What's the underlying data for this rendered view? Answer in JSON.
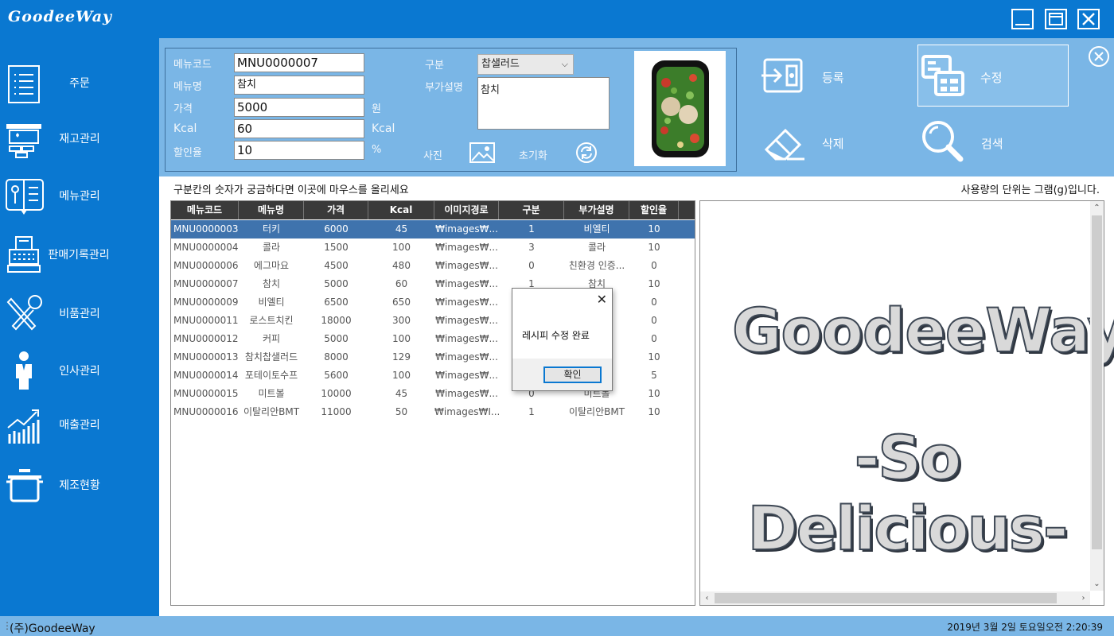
{
  "app": {
    "title": "GoodeeWay"
  },
  "sidebar": {
    "items": [
      {
        "label": "주문",
        "icon": "order-list-icon"
      },
      {
        "label": "재고관리",
        "icon": "inventory-icon"
      },
      {
        "label": "메뉴관리",
        "icon": "menu-icon"
      },
      {
        "label": "판매기록관리",
        "icon": "register-icon"
      },
      {
        "label": "비품관리",
        "icon": "tools-icon"
      },
      {
        "label": "인사관리",
        "icon": "person-icon"
      },
      {
        "label": "매출관리",
        "icon": "sales-chart-icon"
      },
      {
        "label": "제조현황",
        "icon": "pot-icon"
      }
    ]
  },
  "form": {
    "menu_code_label": "메뉴코드",
    "menu_code": "MNU0000007",
    "menu_name_label": "메뉴명",
    "menu_name": "참치",
    "price_label": "가격",
    "price": "5000",
    "price_unit": "원",
    "kcal_label": "Kcal",
    "kcal": "60",
    "kcal_unit": "Kcal",
    "discount_label": "할인율",
    "discount": "10",
    "discount_unit": "%",
    "category_label": "구분",
    "category": "찹샐러드",
    "desc_label": "부가설명",
    "desc": "참치",
    "photo_label": "사진",
    "reset_label": "초기화"
  },
  "actions": {
    "register": "등록",
    "edit": "수정",
    "delete": "삭제",
    "search": "검색"
  },
  "hints": {
    "left": "구분칸의 숫자가 궁금하다면 이곳에 마우스를 올리세요",
    "right": "사용량의 단위는 그램(g)입니다."
  },
  "table": {
    "columns": [
      "메뉴코드",
      "메뉴명",
      "가격",
      "Kcal",
      "이미지경로",
      "구분",
      "부가설명",
      "할인율"
    ],
    "rows": [
      [
        "MNU0000003",
        "터키",
        "6000",
        "45",
        "₩images₩...",
        "1",
        "비엘티",
        "10"
      ],
      [
        "MNU0000004",
        "콜라",
        "1500",
        "100",
        "₩images₩...",
        "3",
        "콜라",
        "10"
      ],
      [
        "MNU0000006",
        "에그마요",
        "4500",
        "480",
        "₩images₩...",
        "0",
        "친환경 인증...",
        "0"
      ],
      [
        "MNU0000007",
        "참치",
        "5000",
        "60",
        "₩images₩...",
        "1",
        "참치",
        "10"
      ],
      [
        "MNU0000009",
        "비엘티",
        "6500",
        "650",
        "₩images₩...",
        "",
        "",
        "0"
      ],
      [
        "MNU0000011",
        "로스트치킨",
        "18000",
        "300",
        "₩images₩...",
        "",
        "킨",
        "0"
      ],
      [
        "MNU0000012",
        "커피",
        "5000",
        "100",
        "₩images₩...",
        "",
        "",
        "0"
      ],
      [
        "MNU0000013",
        "참치찹샐러드",
        "8000",
        "129",
        "₩images₩...",
        "",
        "드",
        "10"
      ],
      [
        "MNU0000014",
        "포테이토수프",
        "5600",
        "100",
        "₩images₩...",
        "",
        "프",
        "5"
      ],
      [
        "MNU0000015",
        "미트볼",
        "10000",
        "45",
        "₩images₩...",
        "0",
        "미트볼",
        "10"
      ],
      [
        "MNU0000016",
        "이탈리안BMT",
        "11000",
        "50",
        "₩images₩I...",
        "1",
        "이탈리안BMT",
        "10"
      ]
    ],
    "selected_index": 0
  },
  "recipe_panel": {
    "line1": "GoodeeWay",
    "line2": "-So Delicious-"
  },
  "dialog": {
    "message": "레시피 수정 완료",
    "ok_label": "확인"
  },
  "status": {
    "company": "(주)GoodeeWay",
    "datetime": "2019년 3월 2일 토요일오전 2:20:39"
  },
  "colors": {
    "primary": "#0a78d1",
    "panel": "#7ab6e6",
    "selected_row": "#3f73ad"
  }
}
